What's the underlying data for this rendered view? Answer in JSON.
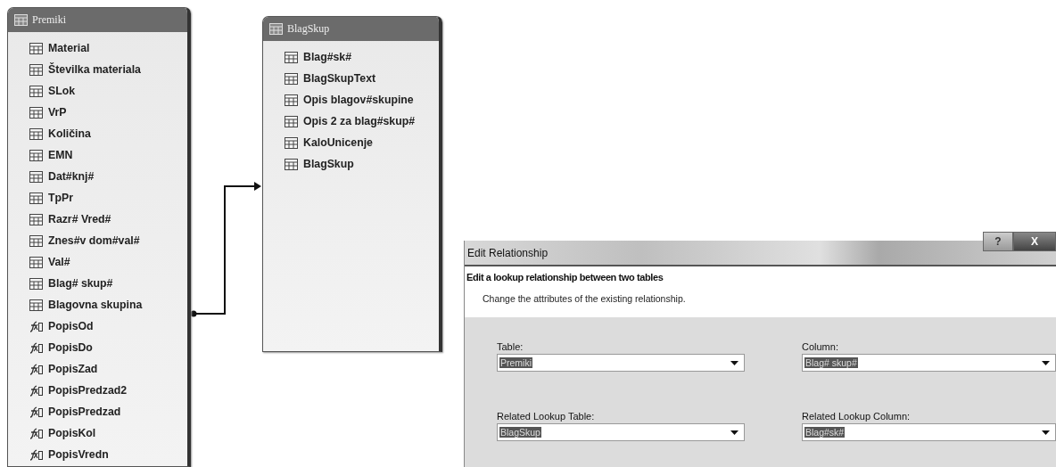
{
  "tables": [
    {
      "title": "Premiki",
      "fields": [
        {
          "name": "Material",
          "kind": "column"
        },
        {
          "name": "Številka materiala",
          "kind": "column"
        },
        {
          "name": "SLok",
          "kind": "column"
        },
        {
          "name": "VrP",
          "kind": "column"
        },
        {
          "name": "Količina",
          "kind": "column"
        },
        {
          "name": "EMN",
          "kind": "column"
        },
        {
          "name": "Dat#knj#",
          "kind": "column"
        },
        {
          "name": "TpPr",
          "kind": "column"
        },
        {
          "name": "Razr# Vred#",
          "kind": "column"
        },
        {
          "name": "Znes#v dom#val#",
          "kind": "column"
        },
        {
          "name": "Val#",
          "kind": "column"
        },
        {
          "name": "Blag# skup#",
          "kind": "column"
        },
        {
          "name": "Blagovna skupina",
          "kind": "column"
        },
        {
          "name": "PopisOd",
          "kind": "calculated"
        },
        {
          "name": "PopisDo",
          "kind": "calculated"
        },
        {
          "name": "PopisZad",
          "kind": "calculated"
        },
        {
          "name": "PopisPredzad2",
          "kind": "calculated"
        },
        {
          "name": "PopisPredzad",
          "kind": "calculated"
        },
        {
          "name": "PopisKol",
          "kind": "calculated"
        },
        {
          "name": "PopisVredn",
          "kind": "calculated"
        }
      ]
    },
    {
      "title": "BlagSkup",
      "fields": [
        {
          "name": "Blag#sk#",
          "kind": "column"
        },
        {
          "name": "BlagSkupText",
          "kind": "column"
        },
        {
          "name": "Opis blagov#skupine",
          "kind": "column"
        },
        {
          "name": "Opis 2 za blag#skup#",
          "kind": "column"
        },
        {
          "name": "KaloUnicenje",
          "kind": "column"
        },
        {
          "name": "BlagSkup",
          "kind": "column"
        }
      ]
    }
  ],
  "dialog": {
    "title": "Edit Relationship",
    "help_button": "?",
    "close_button": "X",
    "heading": "Edit a lookup relationship between two tables",
    "description": "Change the attributes of the existing relationship.",
    "fields": [
      {
        "label": "Table:",
        "value": "Premiki"
      },
      {
        "label": "Column:",
        "value": "Blag# skup#"
      },
      {
        "label": "Related Lookup Table:",
        "value": "BlagSkup"
      },
      {
        "label": "Related Lookup Column:",
        "value": "Blag#sk#"
      }
    ]
  }
}
